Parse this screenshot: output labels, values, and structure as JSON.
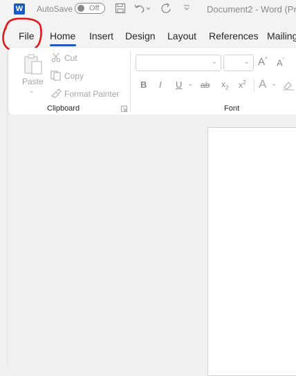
{
  "titlebar": {
    "app_icon": "W",
    "autosave_label": "AutoSave",
    "autosave_state": "Off",
    "icons": [
      "word-icon",
      "save-icon",
      "undo-icon",
      "redo-icon",
      "customize-icon"
    ],
    "document_title": "Document2  -  Word (Pro"
  },
  "tabs": [
    {
      "label": "File"
    },
    {
      "label": "Home"
    },
    {
      "label": "Insert"
    },
    {
      "label": "Design"
    },
    {
      "label": "Layout"
    },
    {
      "label": "References"
    },
    {
      "label": "Mailing"
    }
  ],
  "active_tab": "Home",
  "annotation": {
    "description": "red hand-drawn circle around File tab",
    "color": "#e0191c"
  },
  "clipboard": {
    "paste_label": "Paste",
    "cut_label": "Cut",
    "copy_label": "Copy",
    "format_painter_label": "Format Painter",
    "group_label": "Clipboard"
  },
  "font": {
    "font_name_value": "",
    "font_size_value": "",
    "grow_label": "A",
    "shrink_label": "A",
    "bold": "B",
    "italic": "I",
    "underline": "U",
    "strike": "ab",
    "subscript": "x",
    "superscript": "x",
    "text_effects": "A",
    "group_label": "Font"
  },
  "colors": {
    "accent": "#185abd",
    "annotation_red": "#e0191c"
  }
}
